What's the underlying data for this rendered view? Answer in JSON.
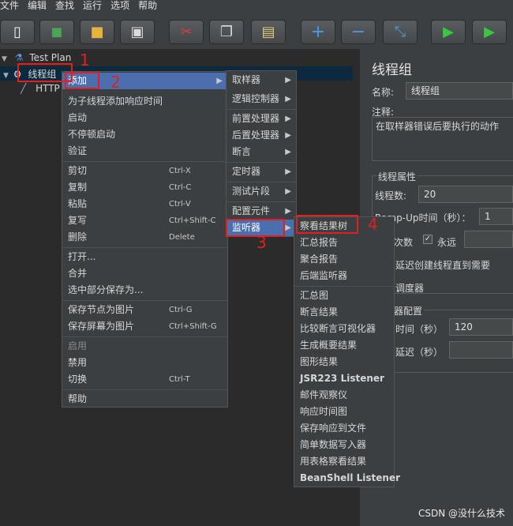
{
  "menubar": [
    "文件",
    "编辑",
    "查找",
    "运行",
    "选项",
    "帮助"
  ],
  "toolbar": {
    "icons": [
      "new-icon",
      "templates-icon",
      "open-icon",
      "save-icon",
      "cut-icon",
      "copy-icon",
      "paste-icon",
      "expand-icon",
      "collapse-icon",
      "toggle-icon",
      "start-icon",
      "start-no-pause-icon"
    ]
  },
  "tree": {
    "test_plan": "Test Plan",
    "thread_group": "线程组",
    "http": "HTTP"
  },
  "context_menu": {
    "add": "添加",
    "add_think_time": "为子线程添加响应时间",
    "start": "启动",
    "start_no_pause": "不停顿启动",
    "validate": "验证",
    "cut": "剪切",
    "cut_key": "Ctrl-X",
    "copy": "复制",
    "copy_key": "Ctrl-C",
    "paste": "粘贴",
    "paste_key": "Ctrl-V",
    "duplicate": "复写",
    "duplicate_key": "Ctrl+Shift-C",
    "delete": "删除",
    "delete_key": "Delete",
    "open": "打开...",
    "merge": "合并",
    "save_selection": "选中部分保存为...",
    "save_node_image": "保存节点为图片",
    "save_node_image_key": "Ctrl-G",
    "save_screen_image": "保存屏幕为图片",
    "save_screen_image_key": "Ctrl+Shift-G",
    "enable": "启用",
    "disable": "禁用",
    "toggle": "切换",
    "toggle_key": "Ctrl-T",
    "help": "帮助"
  },
  "add_submenu": {
    "sampler": "取样器",
    "logic_controller": "逻辑控制器",
    "pre_processor": "前置处理器",
    "post_processor": "后置处理器",
    "assertion": "断言",
    "timer": "定时器",
    "test_fragment": "测试片段",
    "config_element": "配置元件",
    "listener": "监听器"
  },
  "listener_submenu": {
    "group1": [
      "察看结果树",
      "汇总报告",
      "聚合报告",
      "后端监听器"
    ],
    "group2": [
      "汇总图",
      "断言结果",
      "比较断言可视化器",
      "生成概要结果",
      "图形结果",
      "JSR223 Listener",
      "邮件观察仪",
      "响应时间图",
      "保存响应到文件",
      "简单数据写入器",
      "用表格察看结果",
      "BeanShell Listener"
    ]
  },
  "right_panel": {
    "title": "线程组",
    "name_label": "名称:",
    "name_value": "线程组",
    "comment_label": "注释:",
    "on_error_label": "在取样器错误后要执行的动作",
    "thread_props": "线程属性",
    "threads_label": "线程数:",
    "threads_value": "20",
    "rampup_label": "Ramp-Up时间（秒）：",
    "rampup_value": "1",
    "loop_label": "次数",
    "forever_label": "永远",
    "delay_label": "延迟创建线程直到需要",
    "scheduler_label": "调度器",
    "scheduler_config": "器配置",
    "duration_label": "时间（秒）",
    "duration_value": "120",
    "startup_delay_label": "延迟（秒）"
  },
  "annotations": [
    "1",
    "2",
    "3",
    "4"
  ],
  "watermark": "CSDN @没什么技术",
  "colors": {
    "highlight": "#4b6eaf",
    "annotation": "#e02020",
    "tree_bg": "#2b2b2b",
    "panel_bg": "#3c3f41"
  }
}
